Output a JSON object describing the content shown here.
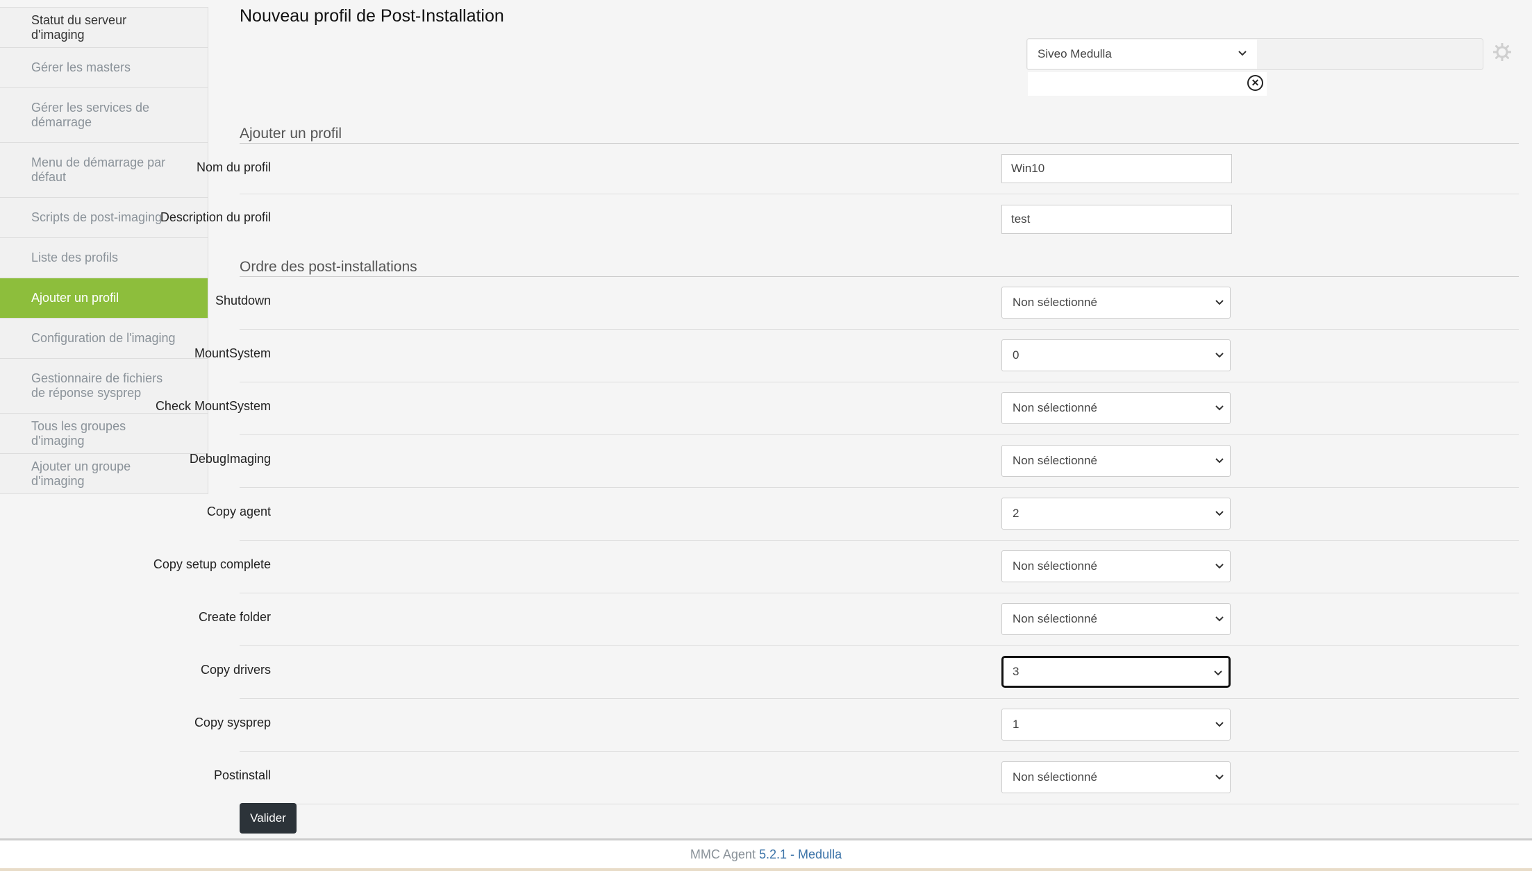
{
  "page": {
    "title": "Nouveau profil de Post-Installation"
  },
  "sidebar": {
    "items": [
      {
        "label": "Statut du serveur d'imaging"
      },
      {
        "label": "Gérer les masters"
      },
      {
        "label": "Gérer les services de démarrage"
      },
      {
        "label": "Menu de démarrage par défaut"
      },
      {
        "label": "Scripts de post-imaging"
      },
      {
        "label": "Liste des profils"
      },
      {
        "label": "Ajouter un profil"
      },
      {
        "label": "Configuration de l'imaging"
      },
      {
        "label": "Gestionnaire de fichiers de réponse sysprep"
      },
      {
        "label": "Tous les groupes d'imaging"
      },
      {
        "label": "Ajouter un groupe d'imaging"
      }
    ],
    "active": "Ajouter un profil"
  },
  "entity": {
    "selected": "Siveo Medulla",
    "icons": [
      "chevron-down-icon",
      "clear-icon",
      "gear-icon"
    ]
  },
  "form": {
    "section_profile": "Ajouter un profil",
    "name_label": "Nom du profil",
    "name_value": "Win10",
    "desc_label": "Description du profil",
    "desc_value": "test",
    "section_order": "Ordre des post-installations",
    "postinstalls": [
      {
        "label": "Shutdown",
        "value": "Non sélectionné"
      },
      {
        "label": "MountSystem",
        "value": "0"
      },
      {
        "label": "Check MountSystem",
        "value": "Non sélectionné"
      },
      {
        "label": "DebugImaging",
        "value": "Non sélectionné"
      },
      {
        "label": "Copy agent",
        "value": "2"
      },
      {
        "label": "Copy setup complete",
        "value": "Non sélectionné"
      },
      {
        "label": "Create folder",
        "value": "Non sélectionné"
      },
      {
        "label": "Copy drivers",
        "value": "3"
      },
      {
        "label": "Copy sysprep",
        "value": "1"
      },
      {
        "label": "Postinstall",
        "value": "Non sélectionné"
      }
    ],
    "submit_label": "Valider"
  },
  "footer": {
    "product": "MMC Agent",
    "version": "5.2.1",
    "separator": "-",
    "brand": "Medulla"
  }
}
